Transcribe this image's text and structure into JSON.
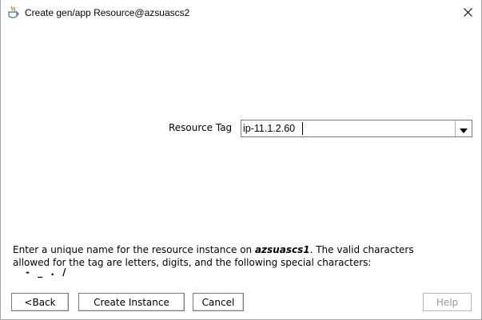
{
  "window": {
    "title": "Create gen/app Resource@azsuascs2"
  },
  "form": {
    "resource_tag_label": "Resource Tag",
    "resource_tag_value": "ip-11.1.2.60"
  },
  "description": {
    "line1_before": "Enter a unique name for the resource instance on ",
    "host": "azsuascs1",
    "line1_after": ". The valid characters",
    "line2": "allowed for the tag are letters, digits, and the following special characters:",
    "special_chars": "- _ . /"
  },
  "buttons": {
    "back": "<Back",
    "create_instance": "Create Instance",
    "cancel": "Cancel",
    "help": "Help"
  },
  "icons": {
    "app": "java-coffee-cup-icon",
    "close": "close-icon",
    "dropdown": "chevron-down-icon"
  }
}
